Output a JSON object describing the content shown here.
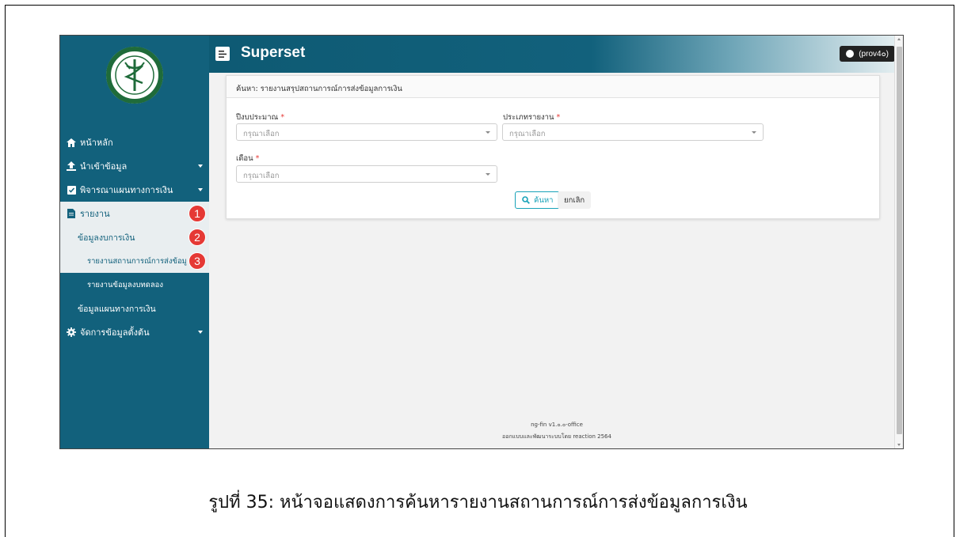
{
  "app": {
    "brand": "Superset",
    "user": "(prov4๐)"
  },
  "sidebar": {
    "home": "หน้าหลัก",
    "import": "นำเข้าข้อมูล",
    "plan_review": "พิจารณาแผนทางการเงิน",
    "report": "รายงาน",
    "report_sub": "ข้อมูลงบการเงิน",
    "report_sub_item1": "รายงานสถานการณ์การส่งข้อมูลการเงิน",
    "report_sub_item2": "รายงานข้อมูลงบทดลอง",
    "plan_data": "ข้อมูลแผนทางการเงิน",
    "master": "จัดการข้อมูลตั้งต้น",
    "badges": [
      "1",
      "2",
      "3"
    ]
  },
  "card": {
    "title": "ค้นหา: รายงานสรุปสถานการณ์การส่งข้อมูลการเงิน",
    "fields": {
      "fiscal_year": {
        "label": "ปีงบประมาณ",
        "required": "*",
        "placeholder": "กรุณาเลือก"
      },
      "report_type": {
        "label": "ประเภทรายงาน",
        "required": "*",
        "placeholder": "กรุณาเลือก"
      },
      "month": {
        "label": "เดือน",
        "required": "*",
        "placeholder": "กรุณาเลือก"
      }
    },
    "search_btn": "ค้นหา",
    "cancel_btn": "ยกเลิก"
  },
  "footer": {
    "version": "ng-fin v1.๐.๐-office",
    "credit": "ออกแบบและพัฒนาระบบโดย reaction 2564"
  },
  "caption": "รูปที่ 35: หน้าจอแสดงการค้นหารายงานสถานการณ์การส่งข้อมูลการเงิน",
  "colors": {
    "sidebar": "#12617c",
    "badge": "#e53935",
    "accent": "#17a2b8"
  }
}
